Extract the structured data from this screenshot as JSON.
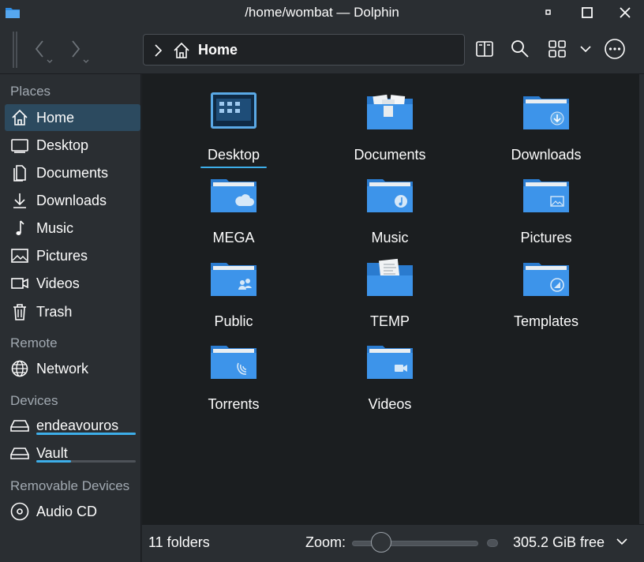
{
  "window": {
    "title": "/home/wombat — Dolphin"
  },
  "toolbar": {
    "back_icon": "chevron-left-icon",
    "forward_icon": "chevron-right-icon",
    "breadcrumb": "Home",
    "split_icon": "split-view-icon",
    "search_icon": "search-icon",
    "view_icon": "grid-view-icon",
    "menu_icon": "hamburger-more-icon"
  },
  "sidebar": {
    "places_label": "Places",
    "places": [
      {
        "label": "Home",
        "icon": "home-icon"
      },
      {
        "label": "Desktop",
        "icon": "desktop-icon"
      },
      {
        "label": "Documents",
        "icon": "documents-icon"
      },
      {
        "label": "Downloads",
        "icon": "download-icon"
      },
      {
        "label": "Music",
        "icon": "music-icon"
      },
      {
        "label": "Pictures",
        "icon": "pictures-icon"
      },
      {
        "label": "Videos",
        "icon": "videos-icon"
      },
      {
        "label": "Trash",
        "icon": "trash-icon"
      }
    ],
    "remote_label": "Remote",
    "remote": [
      {
        "label": "Network",
        "icon": "network-icon"
      }
    ],
    "devices_label": "Devices",
    "devices": [
      {
        "label": "endeavouros",
        "icon": "drive-icon",
        "used_fraction": 1.0
      },
      {
        "label": "Vault",
        "icon": "drive-icon",
        "used_fraction": 0.35
      }
    ],
    "removable_label": "Removable Devices",
    "removable": [
      {
        "label": "Audio CD",
        "icon": "cd-icon"
      }
    ]
  },
  "files": [
    {
      "name": "Desktop",
      "icon": "desktop-folder-icon"
    },
    {
      "name": "Documents",
      "icon": "documents-folder-icon"
    },
    {
      "name": "Downloads",
      "icon": "downloads-folder-icon"
    },
    {
      "name": "MEGA",
      "icon": "cloud-folder-icon"
    },
    {
      "name": "Music",
      "icon": "music-folder-icon"
    },
    {
      "name": "Pictures",
      "icon": "pictures-folder-icon"
    },
    {
      "name": "Public",
      "icon": "public-folder-icon"
    },
    {
      "name": "TEMP",
      "icon": "temp-folder-icon"
    },
    {
      "name": "Templates",
      "icon": "templates-folder-icon"
    },
    {
      "name": "Torrents",
      "icon": "torrents-folder-icon"
    },
    {
      "name": "Videos",
      "icon": "videos-folder-icon"
    }
  ],
  "status": {
    "count": "11 folders",
    "zoom_label": "Zoom:",
    "free_space": "305.2 GiB free"
  },
  "colors": {
    "accent": "#3daee9",
    "folder": "#2f8be0",
    "selection": "#2c4a5f"
  }
}
